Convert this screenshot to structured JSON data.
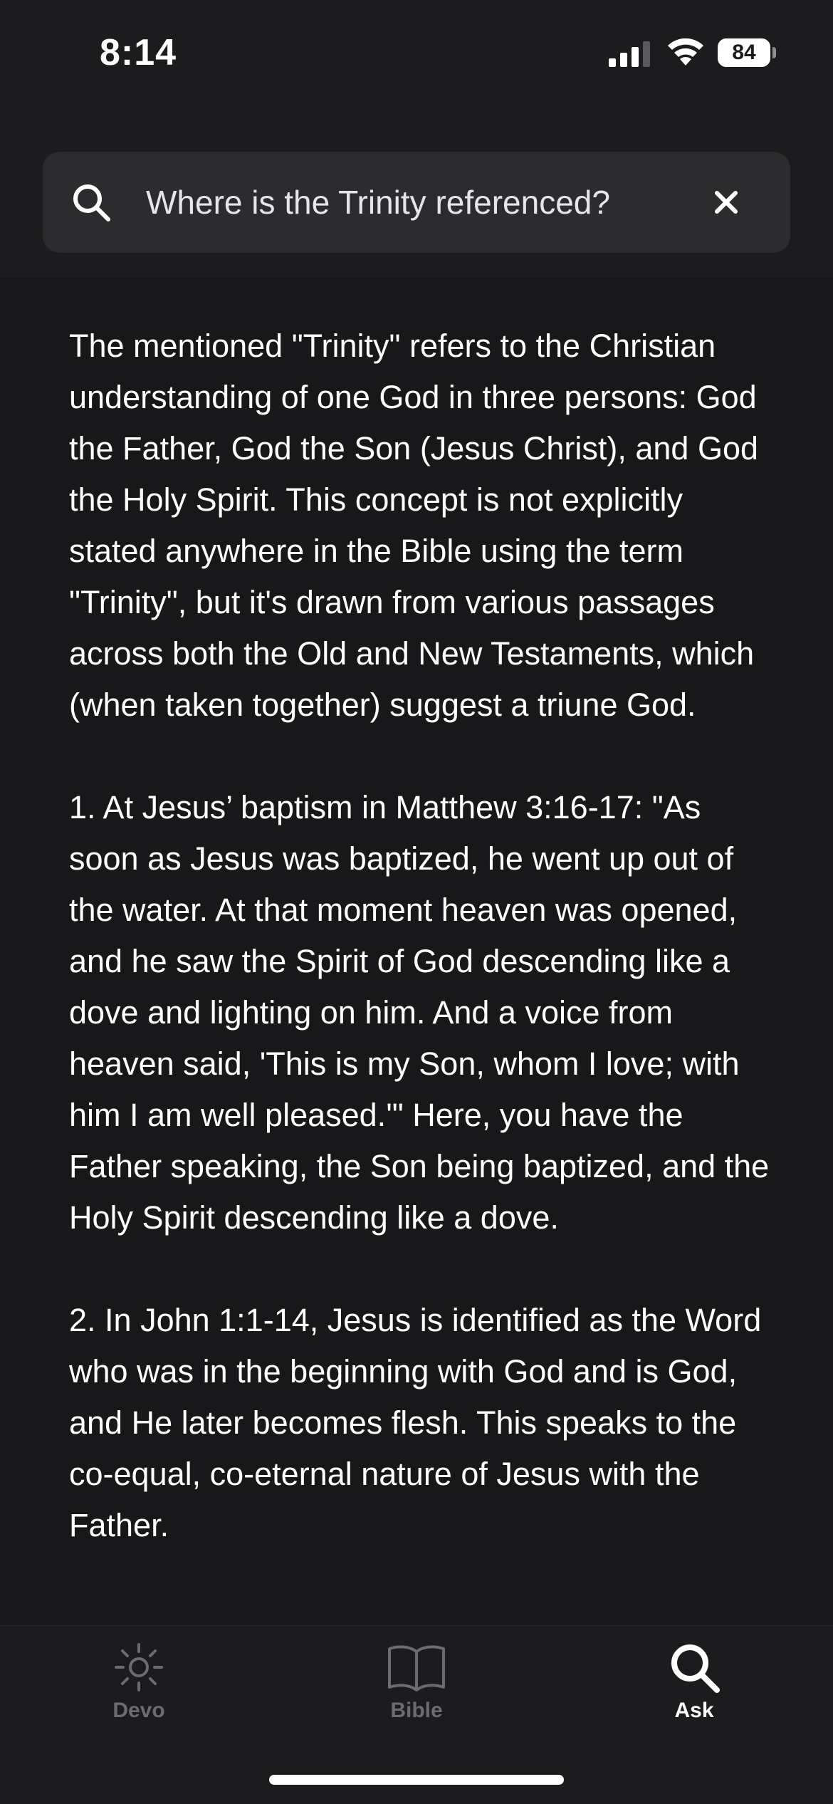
{
  "status_bar": {
    "time": "8:14",
    "battery_level": "84",
    "signal_icon": "cellular-signal-icon",
    "wifi_icon": "wifi-icon",
    "battery_icon": "battery-icon"
  },
  "search": {
    "query": "Where is the Trinity referenced?",
    "icon": "search-icon",
    "clear_icon": "close-icon"
  },
  "answer": {
    "paragraphs": [
      "The mentioned \"Trinity\" refers to the Christian understanding of one God in three persons: God the Father, God the Son (Jesus Christ), and God the Holy Spirit. This concept is not explicitly stated anywhere in the Bible using the term \"Trinity\", but it's drawn from various passages across both the Old and New Testaments, which (when taken together) suggest a triune God.",
      "1. At Jesus’ baptism in Matthew 3:16-17: \"As soon as Jesus was baptized, he went up out of the water. At that moment heaven was opened, and he saw the Spirit of God descending like a dove and lighting on him. And a voice from heaven said, 'This is my Son, whom I love; with him I am well pleased.'\" Here, you have the Father speaking, the Son being baptized, and the Holy Spirit descending like a dove.",
      "2. In John 1:1-14, Jesus is identified as the Word who was in the beginning with God and is God, and He later becomes flesh. This speaks to the co-equal, co-eternal nature of Jesus with the Father."
    ]
  },
  "tabs": [
    {
      "label": "Devo",
      "icon": "sun-icon",
      "active": false
    },
    {
      "label": "Bible",
      "icon": "book-icon",
      "active": false
    },
    {
      "label": "Ask",
      "icon": "search-icon",
      "active": true
    }
  ],
  "colors": {
    "background": "#1c1c1e",
    "content_background": "#18181a",
    "search_bar": "#2c2c2e",
    "text": "#ffffff",
    "inactive_tab": "#6b6b70"
  }
}
